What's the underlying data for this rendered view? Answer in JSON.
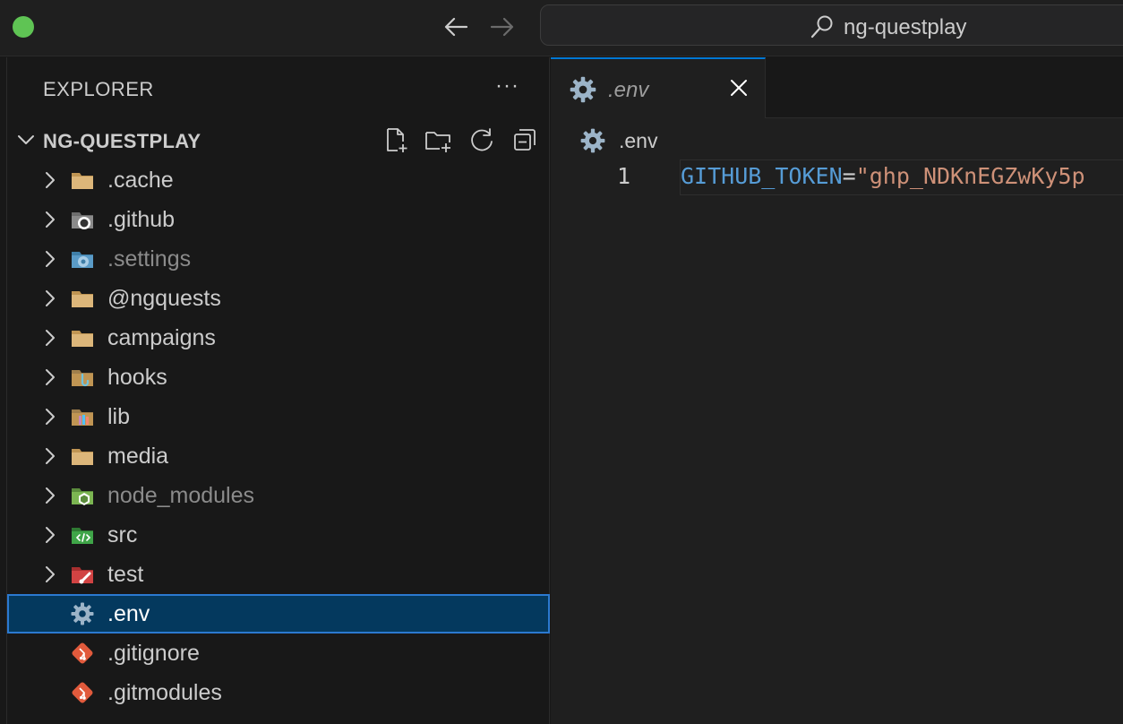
{
  "window": {
    "search_text": "ng-questplay",
    "traffic_color": "#5fc454"
  },
  "sidebar": {
    "title": "EXPLORER",
    "more_label": "···",
    "section_title": "NG-QUESTPLAY",
    "items": [
      {
        "label": ".cache",
        "icon": "folder-icon",
        "type": "folder"
      },
      {
        "label": ".github",
        "icon": "github-folder-icon",
        "type": "folder"
      },
      {
        "label": ".settings",
        "icon": "settings-folder-icon",
        "type": "folder"
      },
      {
        "label": "@ngquests",
        "icon": "folder-icon",
        "type": "folder"
      },
      {
        "label": "campaigns",
        "icon": "folder-icon",
        "type": "folder"
      },
      {
        "label": "hooks",
        "icon": "hooks-folder-icon",
        "type": "folder"
      },
      {
        "label": "lib",
        "icon": "lib-folder-icon",
        "type": "folder"
      },
      {
        "label": "media",
        "icon": "folder-icon",
        "type": "folder"
      },
      {
        "label": "node_modules",
        "icon": "node-folder-icon",
        "type": "folder"
      },
      {
        "label": "src",
        "icon": "src-folder-icon",
        "type": "folder"
      },
      {
        "label": "test",
        "icon": "test-folder-icon",
        "type": "folder"
      },
      {
        "label": ".env",
        "icon": "gear-icon",
        "type": "file",
        "selected": true
      },
      {
        "label": ".gitignore",
        "icon": "git-icon",
        "type": "file"
      },
      {
        "label": ".gitmodules",
        "icon": "git-icon",
        "type": "file"
      }
    ]
  },
  "editor": {
    "tab_label": ".env",
    "breadcrumb": ".env",
    "line_number": "1",
    "code": {
      "key": "GITHUB_TOKEN",
      "op": "=",
      "value": "\"ghp_NDKnEGZwKy5p"
    }
  }
}
